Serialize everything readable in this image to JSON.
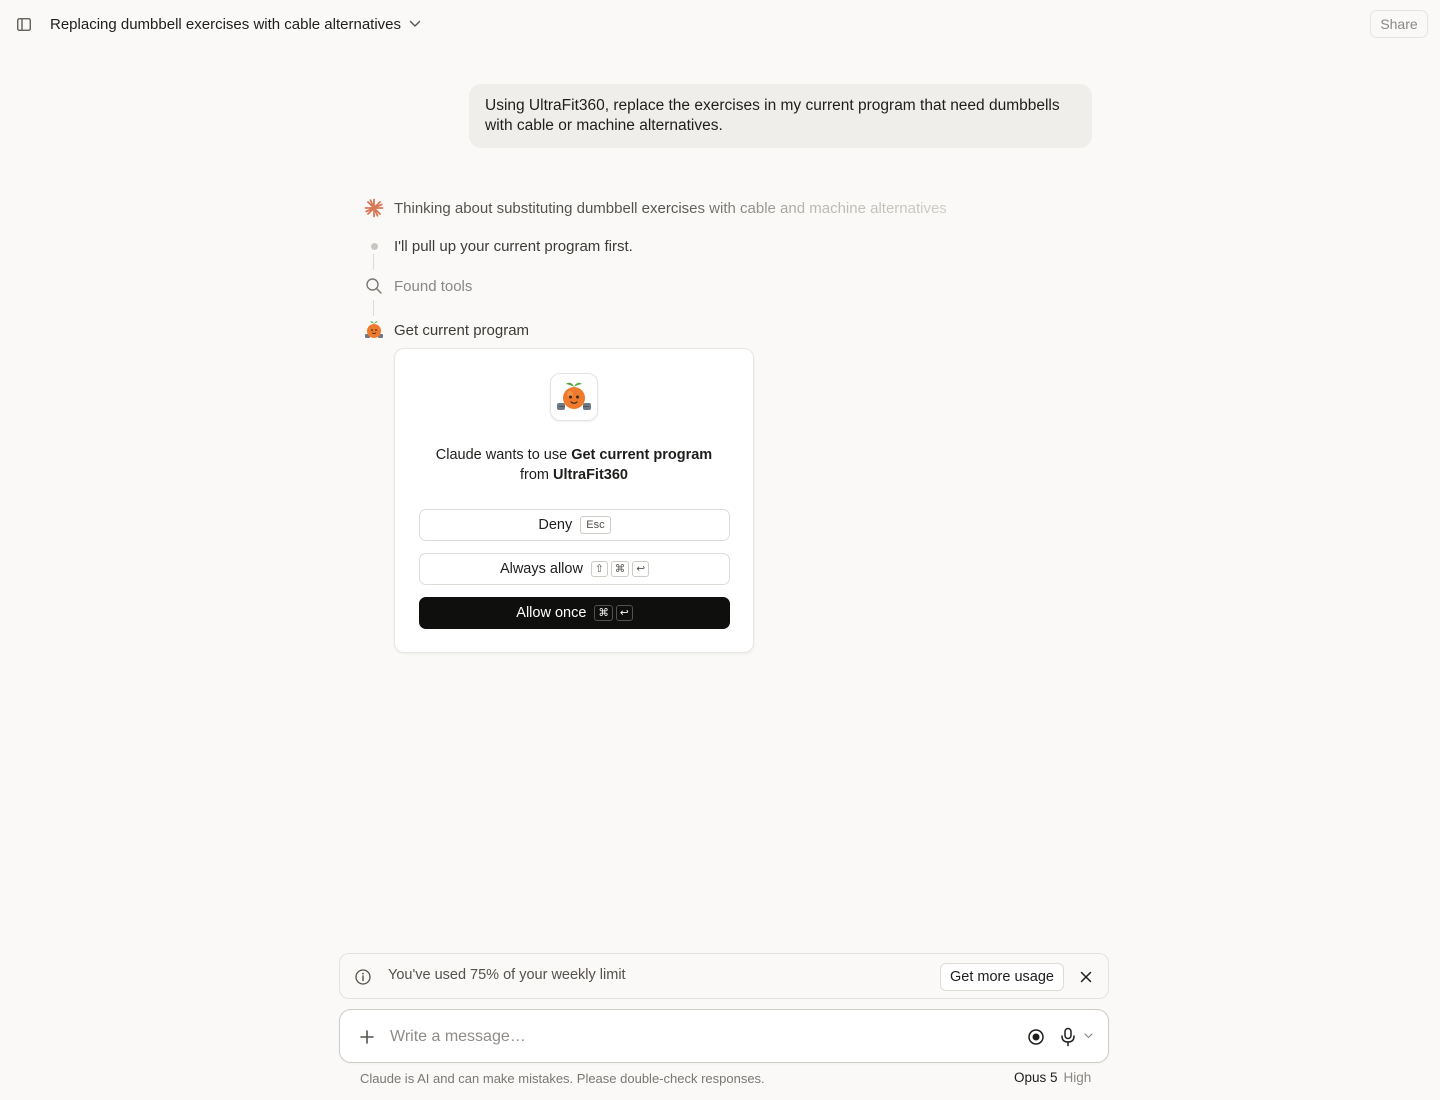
{
  "header": {
    "title": "Replacing dumbbell exercises with cable alternatives",
    "share_label": "Share"
  },
  "conversation": {
    "user_message": "Using UltraFit360, replace the exercises in my current program that need dumbbells with cable or machine alternatives.",
    "thinking": "Thinking about substituting dumbbell exercises with cable and machine alternatives",
    "step_text": "I'll pull up your current program first.",
    "found_tools": "Found tools",
    "tool_call": "Get current program"
  },
  "permission": {
    "prefix": "Claude wants to use ",
    "tool_name": "Get current program",
    "mid": " from ",
    "app_name": "UltraFit360",
    "deny_label": "Deny",
    "deny_key": "Esc",
    "always_label": "Always allow",
    "always_keys": [
      "⇧",
      "⌘",
      "↩"
    ],
    "once_label": "Allow once",
    "once_keys": [
      "⌘",
      "↩"
    ]
  },
  "banner": {
    "text": "You've used 75% of your weekly limit",
    "button_label": "Get more usage"
  },
  "composer": {
    "placeholder": "Write a message…"
  },
  "footer": {
    "disclaimer": "Claude is AI and can make mistakes. Please double-check responses.",
    "model": "Opus 5",
    "effort": "High"
  },
  "colors": {
    "background": "#faf9f7",
    "bubble": "#efeeeb",
    "accent": "#d97757",
    "primary_button": "#0f0f0e"
  }
}
